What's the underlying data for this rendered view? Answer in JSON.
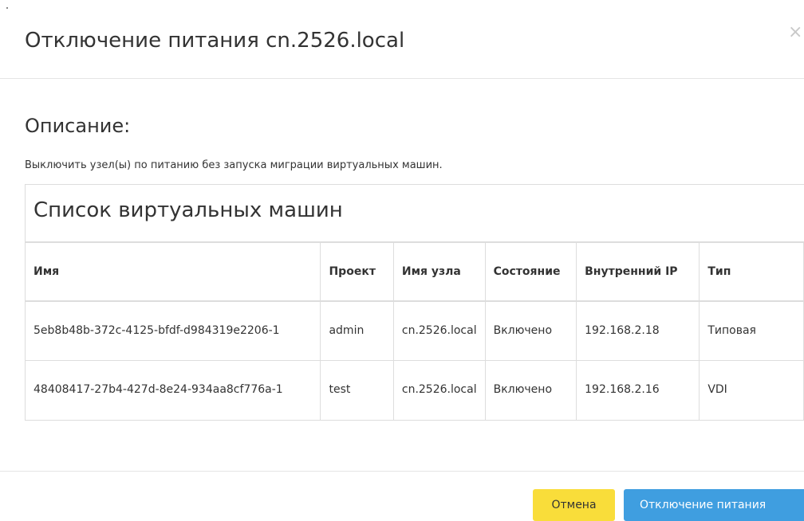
{
  "modal": {
    "title": "Отключение питания cn.2526.local",
    "close_glyph": "×"
  },
  "description": {
    "title": "Описание:",
    "text": "Выключить узел(ы) по питанию без запуска миграции виртуальных машин."
  },
  "vm_list": {
    "title": "Список виртуальных машин",
    "columns": [
      "Имя",
      "Проект",
      "Имя узла",
      "Состояние",
      "Внутренний IP",
      "Тип"
    ],
    "rows": [
      {
        "name": "5eb8b48b-372c-4125-bfdf-d984319e2206-1",
        "project": "admin",
        "host": "cn.2526.local",
        "state": "Включено",
        "ip": "192.168.2.18",
        "type": "Типовая"
      },
      {
        "name": "48408417-27b4-427d-8e24-934aa8cf776a-1",
        "project": "test",
        "host": "cn.2526.local",
        "state": "Включено",
        "ip": "192.168.2.16",
        "type": "VDI"
      }
    ]
  },
  "footer": {
    "cancel_label": "Отмена",
    "submit_label": "Отключение питания"
  },
  "colors": {
    "cancel_button": "#f9dd3a",
    "primary_button": "#3f9ee0",
    "border": "#dddddd"
  }
}
